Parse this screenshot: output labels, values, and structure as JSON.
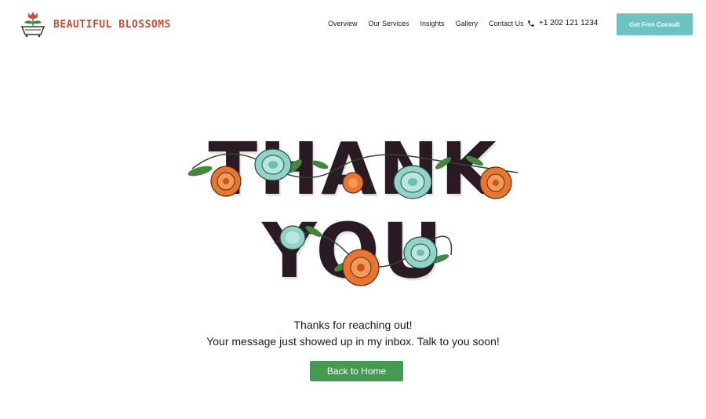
{
  "brand": {
    "name": "BEAUTIFUL BLOSSOMS",
    "icon": "tulip-basket-icon",
    "color": "#cf4a32"
  },
  "nav": {
    "items": [
      {
        "label": "Overview"
      },
      {
        "label": "Our Services"
      },
      {
        "label": "Insights"
      },
      {
        "label": "Gallery"
      },
      {
        "label": "Contact Us"
      }
    ]
  },
  "phone": {
    "number": "+1 202 121 1234",
    "icon": "phone-icon"
  },
  "cta": {
    "label": "Get Free Consult",
    "color": "#6cc3c0"
  },
  "hero": {
    "line1": "THANK",
    "line2": "YOU",
    "letter_color": "#2a1a23",
    "flower_colors": {
      "teal": "#8fd3c9",
      "orange": "#e8762e",
      "leaf": "#3f8a3a"
    }
  },
  "message": {
    "line1": "Thanks for reaching out!",
    "line2": "Your message just showed up in my inbox. Talk to you soon!"
  },
  "home_button": {
    "label": "Back to Home",
    "color": "#449a4e"
  }
}
